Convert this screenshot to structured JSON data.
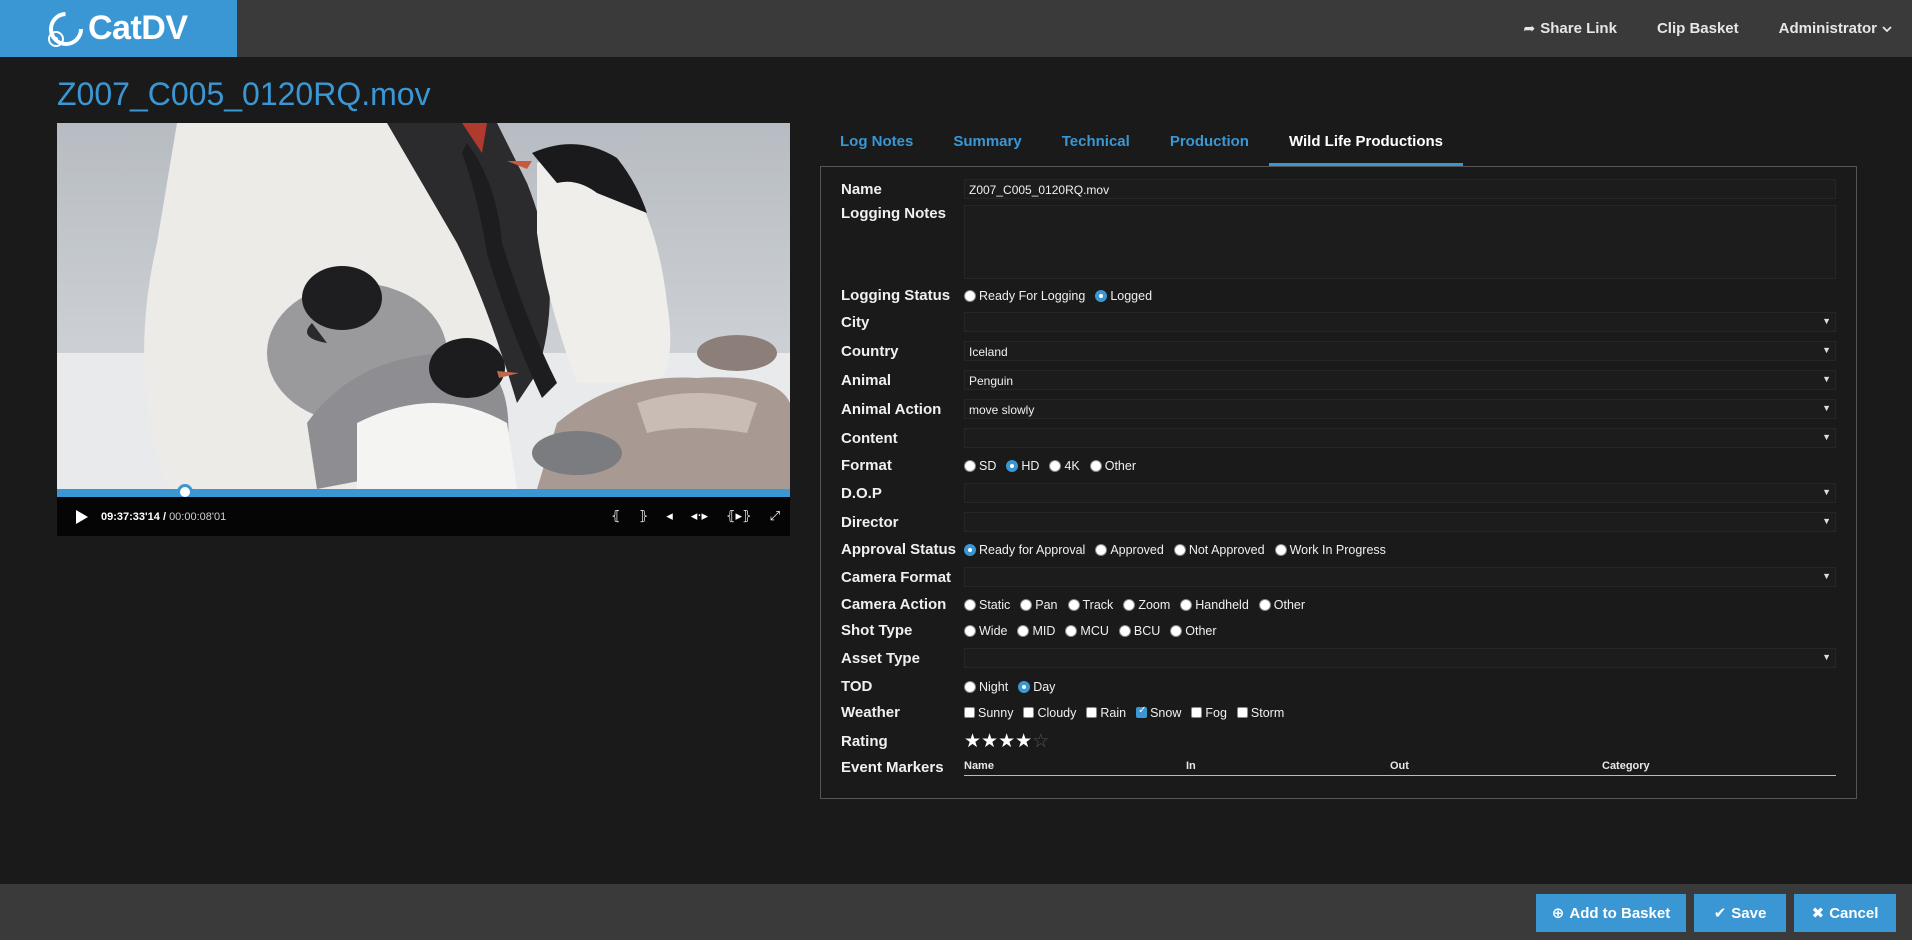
{
  "app": {
    "logo_cat": "Cat",
    "logo_dv": "DV"
  },
  "topnav": {
    "share_link": "Share Link",
    "clip_basket": "Clip Basket",
    "user": "Administrator"
  },
  "clip": {
    "title": "Z007_C005_0120RQ.mov"
  },
  "player": {
    "current_time": "09:37:33'14",
    "separator": " / ",
    "duration": "00:00:08'01",
    "progress": 0.174
  },
  "tabs": [
    {
      "label": "Log Notes"
    },
    {
      "label": "Summary"
    },
    {
      "label": "Technical"
    },
    {
      "label": "Production"
    },
    {
      "label": "Wild Life Productions",
      "active": true
    }
  ],
  "form": {
    "name": {
      "label": "Name",
      "value": "Z007_C005_0120RQ.mov"
    },
    "logging_notes": {
      "label": "Logging Notes",
      "value": ""
    },
    "logging_status": {
      "label": "Logging Status",
      "options": [
        "Ready For Logging",
        "Logged"
      ],
      "selected": "Logged"
    },
    "city": {
      "label": "City",
      "value": ""
    },
    "country": {
      "label": "Country",
      "value": "Iceland"
    },
    "animal": {
      "label": "Animal",
      "value": "Penguin"
    },
    "animal_action": {
      "label": "Animal Action",
      "value": "move slowly"
    },
    "content": {
      "label": "Content",
      "value": ""
    },
    "format": {
      "label": "Format",
      "options": [
        "SD",
        "HD",
        "4K",
        "Other"
      ],
      "selected": "HD"
    },
    "dop": {
      "label": "D.O.P",
      "value": ""
    },
    "director": {
      "label": "Director",
      "value": ""
    },
    "approval_status": {
      "label": "Approval Status",
      "options": [
        "Ready for Approval",
        "Approved",
        "Not Approved",
        "Work In Progress"
      ],
      "selected": "Ready for Approval"
    },
    "camera_format": {
      "label": "Camera Format",
      "value": ""
    },
    "camera_action": {
      "label": "Camera Action",
      "options": [
        "Static",
        "Pan",
        "Track",
        "Zoom",
        "Handheld",
        "Other"
      ],
      "selected": ""
    },
    "shot_type": {
      "label": "Shot Type",
      "options": [
        "Wide",
        "MID",
        "MCU",
        "BCU",
        "Other"
      ],
      "selected": ""
    },
    "asset_type": {
      "label": "Asset Type",
      "value": ""
    },
    "tod": {
      "label": "TOD",
      "options": [
        "Night",
        "Day"
      ],
      "selected": "Day"
    },
    "weather": {
      "label": "Weather",
      "options": [
        "Sunny",
        "Cloudy",
        "Rain",
        "Snow",
        "Fog",
        "Storm"
      ],
      "checked": [
        "Snow"
      ]
    },
    "rating": {
      "label": "Rating",
      "value": 4,
      "max": 5
    },
    "event_markers": {
      "label": "Event Markers",
      "columns": [
        "Name",
        "In",
        "Out",
        "Category"
      ]
    }
  },
  "footer": {
    "add_to_basket": "Add to Basket",
    "save": "Save",
    "cancel": "Cancel"
  },
  "colors": {
    "accent": "#3b97d3",
    "topbar": "#3a3a3a",
    "background": "#1a1a1a"
  }
}
